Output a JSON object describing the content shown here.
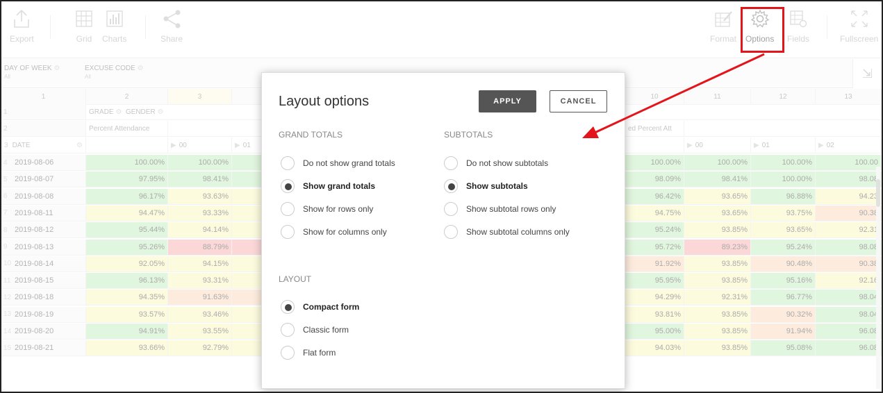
{
  "toolbar": {
    "export": "Export",
    "grid": "Grid",
    "charts": "Charts",
    "share": "Share",
    "format": "Format",
    "options": "Options",
    "fields": "Fields",
    "fullscreen": "Fullscreen"
  },
  "filters": {
    "day_of_week": "DAY OF WEEK",
    "day_of_week_value": "All",
    "excuse_code": "EXCUSE CODE",
    "excuse_code_value": "All"
  },
  "grid": {
    "col_numbers": [
      "1",
      "2",
      "3",
      "10",
      "11",
      "12",
      "13"
    ],
    "row_numbers": [
      "1",
      "2",
      "3"
    ],
    "column_header": "GRADE",
    "column_header_2": "GENDER",
    "measure_left": "Percent Attendance",
    "measure_right": "ed Percent Att",
    "row_header": "DATE",
    "subcols_left": [
      "00",
      "01"
    ],
    "subcols_right": [
      "00",
      "01",
      "02"
    ],
    "rows": [
      {
        "n": "4",
        "date": "2019-08-06",
        "a": "100.00%",
        "b": "100.00%",
        "c": "100.00%",
        "d": "100.00%",
        "e": "100.00%",
        "f": "100.00"
      },
      {
        "n": "5",
        "date": "2019-08-07",
        "a": "97.95%",
        "b": "98.41%",
        "c": "98.09%",
        "d": "98.41%",
        "e": "100.00%",
        "f": "98.08"
      },
      {
        "n": "6",
        "date": "2019-08-08",
        "a": "96.17%",
        "b": "93.63%",
        "c": "96.42%",
        "d": "93.65%",
        "e": "96.88%",
        "f": "94.23"
      },
      {
        "n": "7",
        "date": "2019-08-11",
        "a": "94.47%",
        "b": "93.33%",
        "c": "94.75%",
        "d": "93.65%",
        "e": "93.75%",
        "f": "90.38"
      },
      {
        "n": "8",
        "date": "2019-08-12",
        "a": "95.44%",
        "b": "94.14%",
        "c": "95.24%",
        "d": "93.85%",
        "e": "93.65%",
        "f": "92.31"
      },
      {
        "n": "9",
        "date": "2019-08-13",
        "a": "95.26%",
        "b": "88.79%",
        "c": "95.72%",
        "d": "89.23%",
        "e": "95.24%",
        "f": "98.08"
      },
      {
        "n": "10",
        "date": "2019-08-14",
        "a": "92.05%",
        "b": "94.15%",
        "c": "91.92%",
        "d": "93.85%",
        "e": "90.48%",
        "f": "90.38"
      },
      {
        "n": "11",
        "date": "2019-08-15",
        "a": "96.13%",
        "b": "93.31%",
        "c": "95.95%",
        "d": "93.85%",
        "e": "95.16%",
        "f": "92.16"
      },
      {
        "n": "12",
        "date": "2019-08-18",
        "a": "94.35%",
        "b": "91.63%",
        "c": "94.29%",
        "d": "92.31%",
        "e": "96.77%",
        "f": "98.04"
      },
      {
        "n": "13",
        "date": "2019-08-19",
        "a": "93.57%",
        "b": "93.46%",
        "c": "93.81%",
        "d": "93.85%",
        "e": "90.32%",
        "f": "98.04"
      },
      {
        "n": "14",
        "date": "2019-08-20",
        "a": "94.91%",
        "b": "93.55%",
        "c": "95.00%",
        "d": "93.85%",
        "e": "91.94%",
        "f": "96.08"
      },
      {
        "n": "15",
        "date": "2019-08-21",
        "a": "93.66%",
        "b": "92.79%",
        "c": "94.03%",
        "d": "93.85%",
        "e": "95.08%",
        "f": "96.08"
      }
    ]
  },
  "modal": {
    "title": "Layout options",
    "apply": "APPLY",
    "cancel": "CANCEL",
    "grand_totals_title": "GRAND TOTALS",
    "subtotals_title": "SUBTOTALS",
    "layout_title": "LAYOUT",
    "grand_totals": [
      "Do not show grand totals",
      "Show grand totals",
      "Show for rows only",
      "Show for columns only"
    ],
    "subtotals": [
      "Do not show subtotals",
      "Show subtotals",
      "Show subtotal rows only",
      "Show subtotal columns only"
    ],
    "layouts": [
      "Compact form",
      "Classic form",
      "Flat form"
    ]
  },
  "colors": {
    "highlight": "#e3141a",
    "apply_bg": "#555555",
    "good": "#c9efc3",
    "warn": "#fbf7c2",
    "low": "#fbdcc1",
    "bad": "#f7b6b8"
  }
}
